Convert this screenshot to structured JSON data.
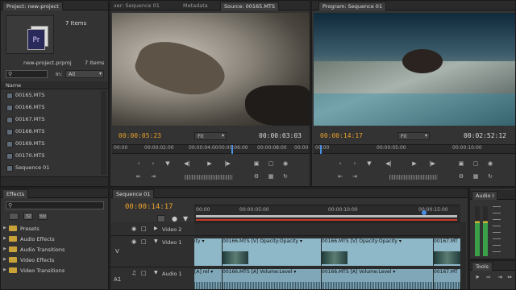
{
  "project": {
    "tab": "Project: new-project",
    "items_count": "7 Items",
    "items_count2": "7 Items",
    "file_name": "new-project.prproj",
    "in_label": "In:",
    "in_value": "All",
    "name_header": "Name",
    "files": [
      "00165.MTS",
      "00166.MTS",
      "00167.MTS",
      "00168.MTS",
      "00169.MTS",
      "00170.MTS",
      "Sequence 01"
    ]
  },
  "source": {
    "tabs": [
      "xer: Sequence 01",
      "Metadata",
      "Source: 00165.MTS"
    ],
    "timecode": "00:00:05:23",
    "fit": "Fit",
    "duration": "00:00:03:03",
    "ruler": [
      "00:00",
      "00:00:02:00",
      "00:00:04:00",
      "00:00:06:00",
      "00:00:08:00",
      "00:00"
    ]
  },
  "program": {
    "tab": "Program: Sequence 01",
    "timecode": "00:00:14:17",
    "fit": "Fit",
    "duration": "00:02:52:12",
    "ruler": [
      "00:00",
      "00:00:05:00",
      "00:00:10:00"
    ]
  },
  "effects": {
    "tab": "Effects",
    "folders": [
      "Presets",
      "Audio Effects",
      "Audio Transitions",
      "Video Effects",
      "Video Transitions"
    ]
  },
  "timeline": {
    "tab": "Sequence 01",
    "timecode": "00:00:14:17",
    "ruler": [
      "00:00",
      "00:00:05:00",
      "00:00:10:00",
      "00:00:15:00"
    ],
    "tracks": {
      "video2": "Video 2",
      "video1": "Video 1",
      "audio1": "Audio 1",
      "v_label": "V",
      "a_label": "A1"
    },
    "video_clips": [
      "ity ▾",
      "00166.MTS [V]  Opacity:Opacity ▾",
      "00166.MTS [V]  Opacity:Opacity ▾",
      "00167.MT"
    ],
    "audio_clips": [
      "[A]  rel ▾",
      "00166.MTS [A]  Volume:Level ▾",
      "00166.MTS [A]  Volume:Level ▾",
      "00167.MT"
    ]
  },
  "audio_meters": {
    "tab": "Audio I"
  },
  "tools": {
    "tab": "Tools"
  }
}
